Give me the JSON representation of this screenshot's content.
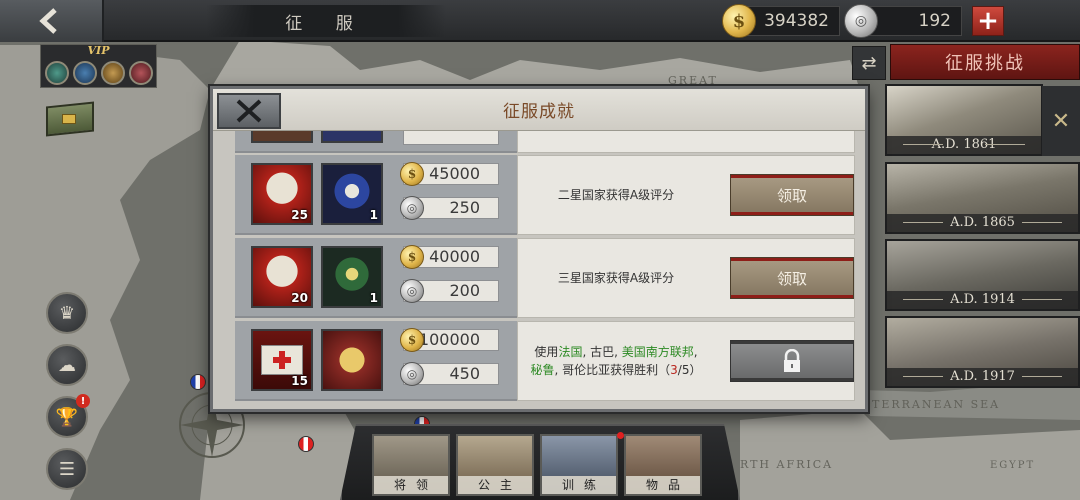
{
  "header": {
    "back_icon": "back-arrow-icon",
    "title": "征 服"
  },
  "resources": {
    "gold": {
      "icon": "gold-coin-icon",
      "value": "394382"
    },
    "silver": {
      "icon": "silver-coin-icon",
      "value": "192"
    },
    "add_icon": "plus-icon"
  },
  "vip": {
    "label": "VIP"
  },
  "side_menu": [
    {
      "name": "general-badge",
      "icon": "laurel-crest-icon"
    },
    {
      "name": "cloud-save",
      "icon": "cloud-upload-icon"
    },
    {
      "name": "trophy",
      "icon": "trophy-icon",
      "badge": "!"
    },
    {
      "name": "tasks",
      "icon": "scroll-icon"
    }
  ],
  "right_panel": {
    "tab_label": "征服挑战",
    "eras": [
      "A.D. 1861",
      "A.D. 1865",
      "A.D. 1914",
      "A.D. 1917"
    ]
  },
  "map_labels": [
    "GREAT",
    "TERRANEAN SEA",
    "RTH AFRICA",
    "EGYPT"
  ],
  "dialog": {
    "title": "征服成就",
    "rows": [
      {
        "items": [
          {
            "icon": "medic-helmet-icon",
            "count": "25"
          },
          {
            "icon": "naval-anchor-medal-icon",
            "count": "1"
          }
        ],
        "gold": "45000",
        "silver": "250",
        "description": "二星国家获得A级评分",
        "button": "领取"
      },
      {
        "items": [
          {
            "icon": "medic-helmet-icon",
            "count": "20"
          },
          {
            "icon": "green-star-medal-icon",
            "count": "1"
          }
        ],
        "gold": "40000",
        "silver": "200",
        "description": "三星国家获得A级评分",
        "button": "领取"
      },
      {
        "items": [
          {
            "icon": "first-aid-kit-icon",
            "count": "15"
          },
          {
            "icon": "gold-cannon-medal-icon",
            "count": ""
          }
        ],
        "gold": "100000",
        "silver": "450",
        "description_parts": {
          "prefix": "使用",
          "c1": "法国",
          "sep1": ", 古巴, ",
          "c2": "美国南方联邦",
          "sep2": ", ",
          "c3": "秘鲁",
          "suffix": ", 哥伦比亚获得胜利（",
          "progress_done": "3",
          "progress_total": "/5）"
        },
        "button_icon": "lock-icon"
      }
    ]
  },
  "dock": [
    {
      "label": "将领",
      "has_dot": false
    },
    {
      "label": "公主",
      "has_dot": false
    },
    {
      "label": "训练",
      "has_dot": true
    },
    {
      "label": "物品",
      "has_dot": false
    }
  ]
}
